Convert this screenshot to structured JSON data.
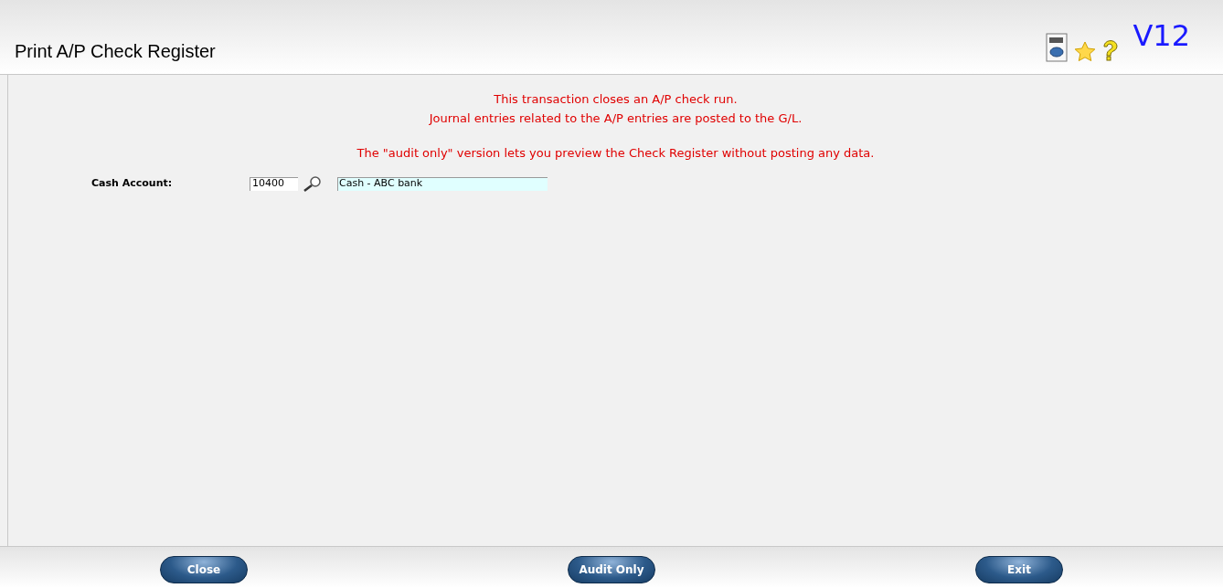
{
  "window": {
    "title": "Print A/P Check Register",
    "version": "V12"
  },
  "notice": [
    "This transaction closes an A/P check run.",
    "Journal entries related to the A/P entries are posted to the G/L.",
    "The \"audit only\" version lets you preview the Check Register without posting any data."
  ],
  "form": {
    "label": "Cash Account:",
    "account": "10400",
    "description": "Cash - ABC bank"
  },
  "buttons": [
    "Close",
    "Audit Only",
    "Exit"
  ]
}
